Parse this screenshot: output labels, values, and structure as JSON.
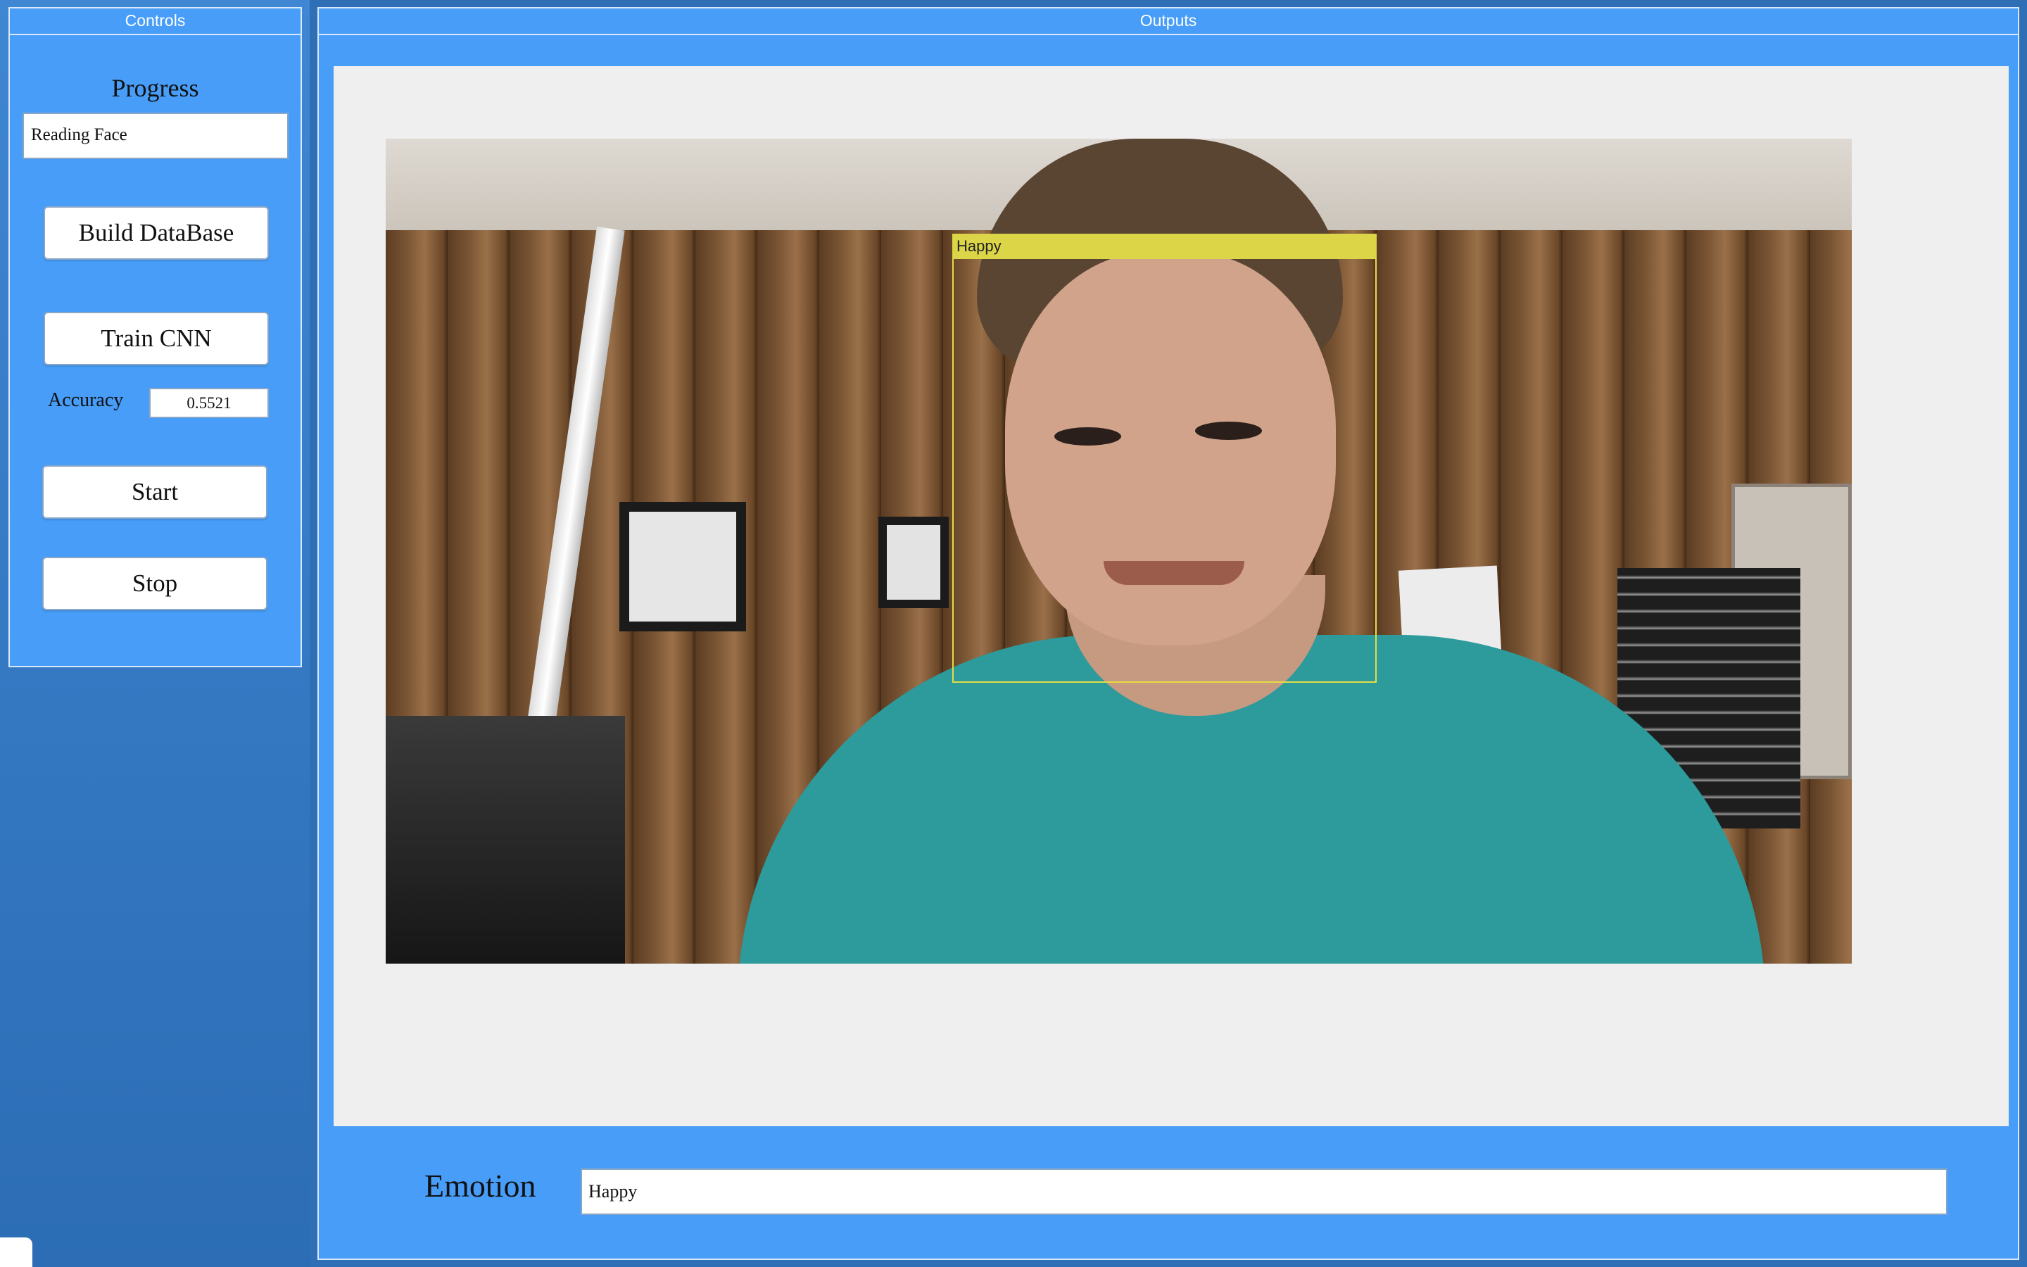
{
  "controls": {
    "title": "Controls",
    "progress_label": "Progress",
    "progress_value": "Reading Face",
    "build_db_label": "Build DataBase",
    "train_cnn_label": "Train CNN",
    "accuracy_label": "Accuracy",
    "accuracy_value": "0.5521",
    "start_label": "Start",
    "stop_label": "Stop"
  },
  "outputs": {
    "title": "Outputs",
    "detection_label": "Happy",
    "emotion_label": "Emotion",
    "emotion_value": "Happy"
  }
}
